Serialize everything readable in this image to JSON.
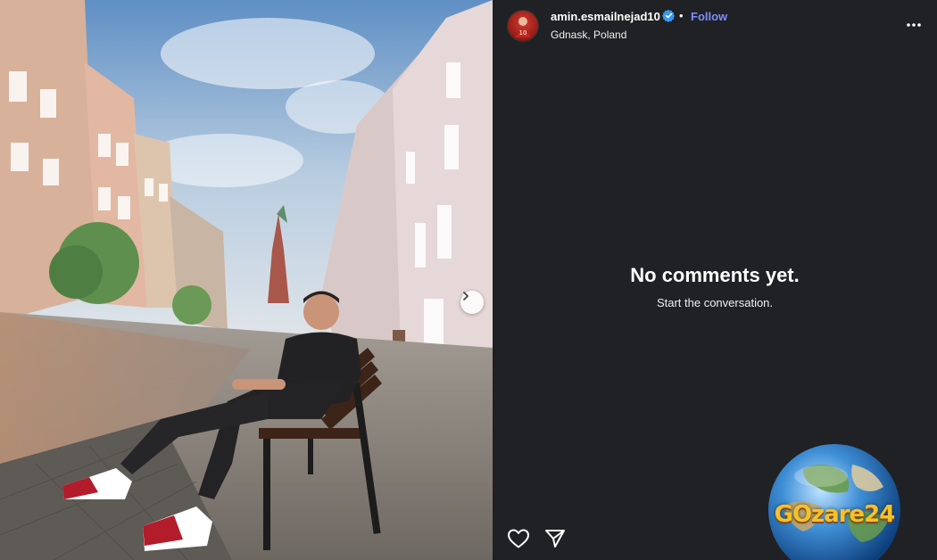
{
  "post": {
    "username": "amin.esmailnejad10",
    "location": "Gdnask, Poland",
    "follow_label": "Follow",
    "separator": "•"
  },
  "comments": {
    "empty_title": "No comments yet.",
    "empty_subtitle": "Start the conversation."
  },
  "watermark": {
    "text": "GOzare24"
  },
  "icons": {
    "verified": "verified-badge-icon",
    "more": "more-options-icon",
    "like": "heart-icon",
    "share": "send-icon",
    "next": "chevron-right-icon"
  },
  "colors": {
    "panel_bg": "#202124",
    "follow": "#7c8dff",
    "verified": "#3897f0"
  }
}
